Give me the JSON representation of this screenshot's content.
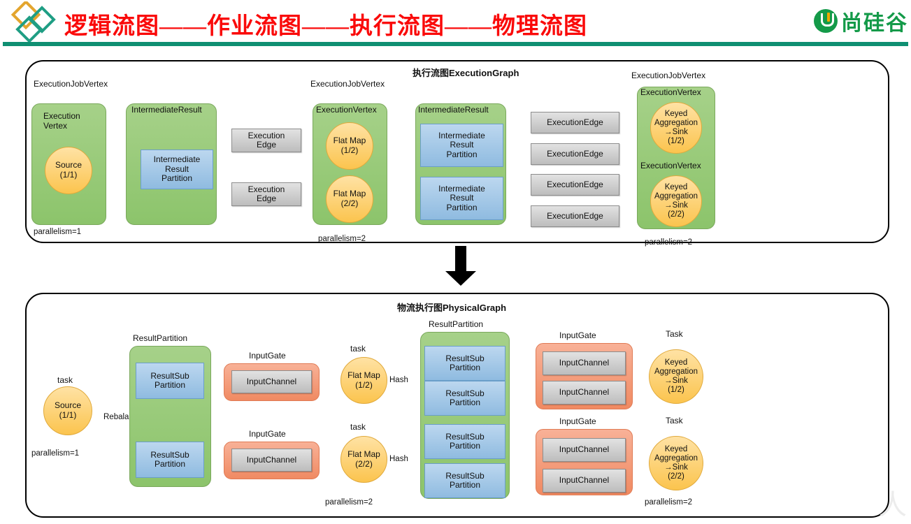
{
  "header": {
    "title": "逻辑流图——作业流图——执行流图——物理流图",
    "brand": "尚硅谷",
    "title_color": "#fa0a0a",
    "brand_color": "#149a49",
    "rule_color": "#0f8f72",
    "left_logo_icon": "diamond-logo-icon",
    "right_logo_icon": "shangguigu-u-logo-icon"
  },
  "watermark": "人",
  "palette": {
    "green": "#8cc46b",
    "blue": "#8fbbe0",
    "orange": "#f08a62",
    "gray": "#bdbdbd",
    "yellow": "#fbc44e"
  },
  "top_panel": {
    "title": "执行流图ExecutionGraph",
    "group_labels": [
      "ExecutionJobVertex",
      "ExecutionJobVertex",
      "ExecutionJobVertex"
    ],
    "inner_labels": {
      "execution_vertex_1": "Execution\nVertex",
      "intermediate_result_1": "IntermediateResult",
      "execution_vertex_2": "ExecutionVertex",
      "intermediate_result_2": "IntermediateResult",
      "execution_vertex_3a": "ExecutionVertex",
      "execution_vertex_3b": "ExecutionVertex"
    },
    "nodes": {
      "source": "Source\n(1/1)",
      "flatmap_1": "Flat Map\n(1/2)",
      "flatmap_2": "Flat Map\n(2/2)",
      "sink_1": "Keyed\nAggregation\n→Sink\n(1/2)",
      "sink_2": "Keyed\nAggregation\n→Sink\n(2/2)"
    },
    "irp_label": "Intermediate\nResult\nPartition",
    "execution_edge_label": "ExecutionEdge",
    "execution_edge_label_wrapped": "Execution\nEdge",
    "parallelism": [
      "parallelism=1",
      "parallelism=2",
      "parallelism=2"
    ]
  },
  "bottom_panel": {
    "title": "物流执行图PhysicalGraph",
    "labels": {
      "task": "task",
      "Task": "Task",
      "result_partition": "ResultPartition",
      "input_gate": "InputGate",
      "rebalance": "Rebalance",
      "hash": "Hash"
    },
    "nodes": {
      "source": "Source\n(1/1)",
      "flatmap_1": "Flat Map\n(1/2)",
      "flatmap_2": "Flat Map\n(2/2)",
      "sink_1": "Keyed\nAggregation\n→Sink\n(1/2)",
      "sink_2": "Keyed\nAggregation\n→Sink\n(2/2)"
    },
    "result_sub_partition": "ResultSub\nPartition",
    "input_channel": "InputChannel",
    "parallelism": [
      "parallelism=1",
      "parallelism=2",
      "parallelism=2"
    ]
  }
}
